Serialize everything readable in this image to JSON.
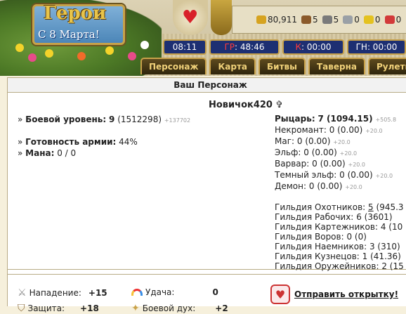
{
  "header": {
    "logo_title": "Герои",
    "logo_subtitle": "С 8 Марта!",
    "resources": [
      {
        "icon": "gold-icon",
        "value": "80,911",
        "color": "#d6a320"
      },
      {
        "icon": "wood-icon",
        "value": "5",
        "color": "#8b5a2b"
      },
      {
        "icon": "ore-icon",
        "value": "5",
        "color": "#7a7a7a"
      },
      {
        "icon": "mercury-icon",
        "value": "0",
        "color": "#9aa0a6"
      },
      {
        "icon": "sulfur-icon",
        "value": "0",
        "color": "#e4c220"
      },
      {
        "icon": "crystal-icon",
        "value": "0",
        "color": "#d23a3a"
      }
    ],
    "timers": [
      {
        "label": "08:11"
      },
      {
        "prefix": "ГР",
        "value": ": 48:46"
      },
      {
        "prefix": "К",
        "value": ": 00:00"
      },
      {
        "label": "ГН: 00:00"
      }
    ],
    "nav": [
      "Персонаж",
      "Карта",
      "Битвы",
      "Таверна",
      "Рулетка"
    ]
  },
  "panel_title": "Ваш Персонаж",
  "character": {
    "nickname": "Новичок420",
    "combat_level_label": "Боевой уровень:",
    "combat_level": "9",
    "combat_level_exp": "(1512298)",
    "combat_level_next": "+137702",
    "army_label": "Готовность армии:",
    "army_value": "44%",
    "mana_label": "Мана:",
    "mana_value": "0 / 0"
  },
  "factions": [
    {
      "label": "Рыцарь:",
      "value": "7 (1094.15)",
      "bonus": "+505.8",
      "bold": true
    },
    {
      "label": "Некромант:",
      "value": "0 (0.00)",
      "bonus": "+20.0"
    },
    {
      "label": "Маг:",
      "value": "0 (0.00)",
      "bonus": "+20.0"
    },
    {
      "label": "Эльф:",
      "value": "0 (0.00)",
      "bonus": "+20.0"
    },
    {
      "label": "Варвар:",
      "value": "0 (0.00)",
      "bonus": "+20.0"
    },
    {
      "label": "Темный эльф:",
      "value": "0 (0.00)",
      "bonus": "+20.0"
    },
    {
      "label": "Демон:",
      "value": "0 (0.00)",
      "bonus": "+20.0"
    }
  ],
  "guilds": [
    {
      "label": "Гильдия Охотников:",
      "level": "5",
      "value": "(945.3"
    },
    {
      "label": "Гильдия Рабочих:",
      "value": "6 (3601)"
    },
    {
      "label": "Гильдия Картежников:",
      "value": "4 (10"
    },
    {
      "label": "Гильдия Воров:",
      "value": "0 (0)"
    },
    {
      "label": "Гильдия Наемников:",
      "value": "3 (310)"
    },
    {
      "label": "Гильдия Кузнецов:",
      "value": "1 (41.36)"
    },
    {
      "label": "Гильдия Оружейников:",
      "value": "2 (15"
    }
  ],
  "bottom": {
    "attack_label": "Нападение:",
    "attack_value": "+15",
    "luck_label": "Удача:",
    "luck_value": "0",
    "defense_label": "Защита:",
    "defense_value": "+18",
    "morale_label": "Боевой дух:",
    "morale_value": "+2",
    "send_card": "Отправить открытку!"
  }
}
